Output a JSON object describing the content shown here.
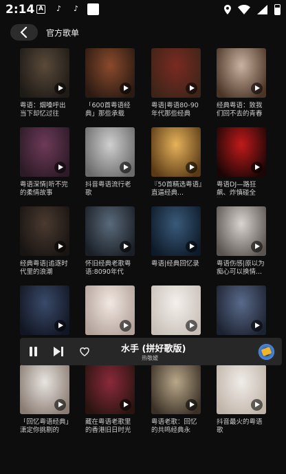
{
  "status_bar": {
    "time": "2:14",
    "left_icons": [
      "a-notification-icon",
      "tiktok-icon",
      "tiktok-icon",
      "square-notification-icon"
    ],
    "right_icons": [
      "location-icon",
      "wifi-icon",
      "signal-icon",
      "battery-icon"
    ]
  },
  "header": {
    "back_icon": "chevron-left-icon",
    "title": "官方歌单"
  },
  "playlists": [
    {
      "title": "粤语：烟嗓呼出当下却忆过往",
      "colors": [
        "#5a4a3a",
        "#1e1a16"
      ]
    },
    {
      "title": "「600首粤语经典」那些承载记...",
      "colors": [
        "#8a4a2c",
        "#2a1a12"
      ]
    },
    {
      "title": "粤语|粤语80-90年代那些经典之...",
      "colors": [
        "#7a2a22",
        "#3e2418"
      ]
    },
    {
      "title": "经典粤语：致我们回不去的青春",
      "colors": [
        "#c9b2a0",
        "#4a3426"
      ]
    },
    {
      "title": "粤语深情|听不完的柔情故事",
      "colors": [
        "#6d3a58",
        "#2c1a26"
      ]
    },
    {
      "title": "抖音粤语流行老歌",
      "colors": [
        "#cfcfcf",
        "#6a6a6a"
      ]
    },
    {
      "title": "『50首精选粤语』直逼经典...",
      "colors": [
        "#e6b25a",
        "#5a3a16"
      ]
    },
    {
      "title": "粤语DJ—路狂飙、炸慎碰全抛...",
      "colors": [
        "#c01a1a",
        "#1a0606"
      ]
    },
    {
      "title": "经典粤语|追逐时代里的浪潮",
      "colors": [
        "#4a3a30",
        "#181412"
      ]
    },
    {
      "title": "怀旧经典老歌粤语:8090年代流...",
      "colors": [
        "#5a6a7a",
        "#1a1f26"
      ]
    },
    {
      "title": "粤语|经典回忆录",
      "colors": [
        "#3a5a7a",
        "#0e1a28"
      ]
    },
    {
      "title": "粤语伤感|原以为痴心可以换情...",
      "colors": [
        "#d8d4d0",
        "#5a5450"
      ]
    },
    {
      "title": "",
      "colors": [
        "#3a4a6a",
        "#111622"
      ]
    },
    {
      "title": "",
      "colors": [
        "#f2e8e2",
        "#b2a29a"
      ]
    },
    {
      "title": "",
      "colors": [
        "#f4f0ec",
        "#c8c0b8"
      ]
    },
    {
      "title": "",
      "colors": [
        "#5a6a8a",
        "#1c2230"
      ]
    },
    {
      "title": "「回忆粤语经典」潇定你挑剔的双...",
      "colors": [
        "#e8e4e0",
        "#8a7c72"
      ]
    },
    {
      "title": "藏在粤语老歌里的香港旧日时光",
      "colors": [
        "#8a2a3a",
        "#2a1410"
      ]
    },
    {
      "title": "粤语老歌：回忆的共鸣经典永流...",
      "colors": [
        "#b8a88a",
        "#3a3026"
      ]
    },
    {
      "title": "抖音最火的粤语歌",
      "colors": [
        "#f0ece8",
        "#c0b4a8"
      ]
    }
  ],
  "player": {
    "song": "水手 (拼好歌版)",
    "artist": "热敬嫒",
    "pause_icon": "pause-icon",
    "next_icon": "next-icon",
    "like_icon": "heart-outline-icon",
    "disc_icon": "album-disc-icon"
  }
}
